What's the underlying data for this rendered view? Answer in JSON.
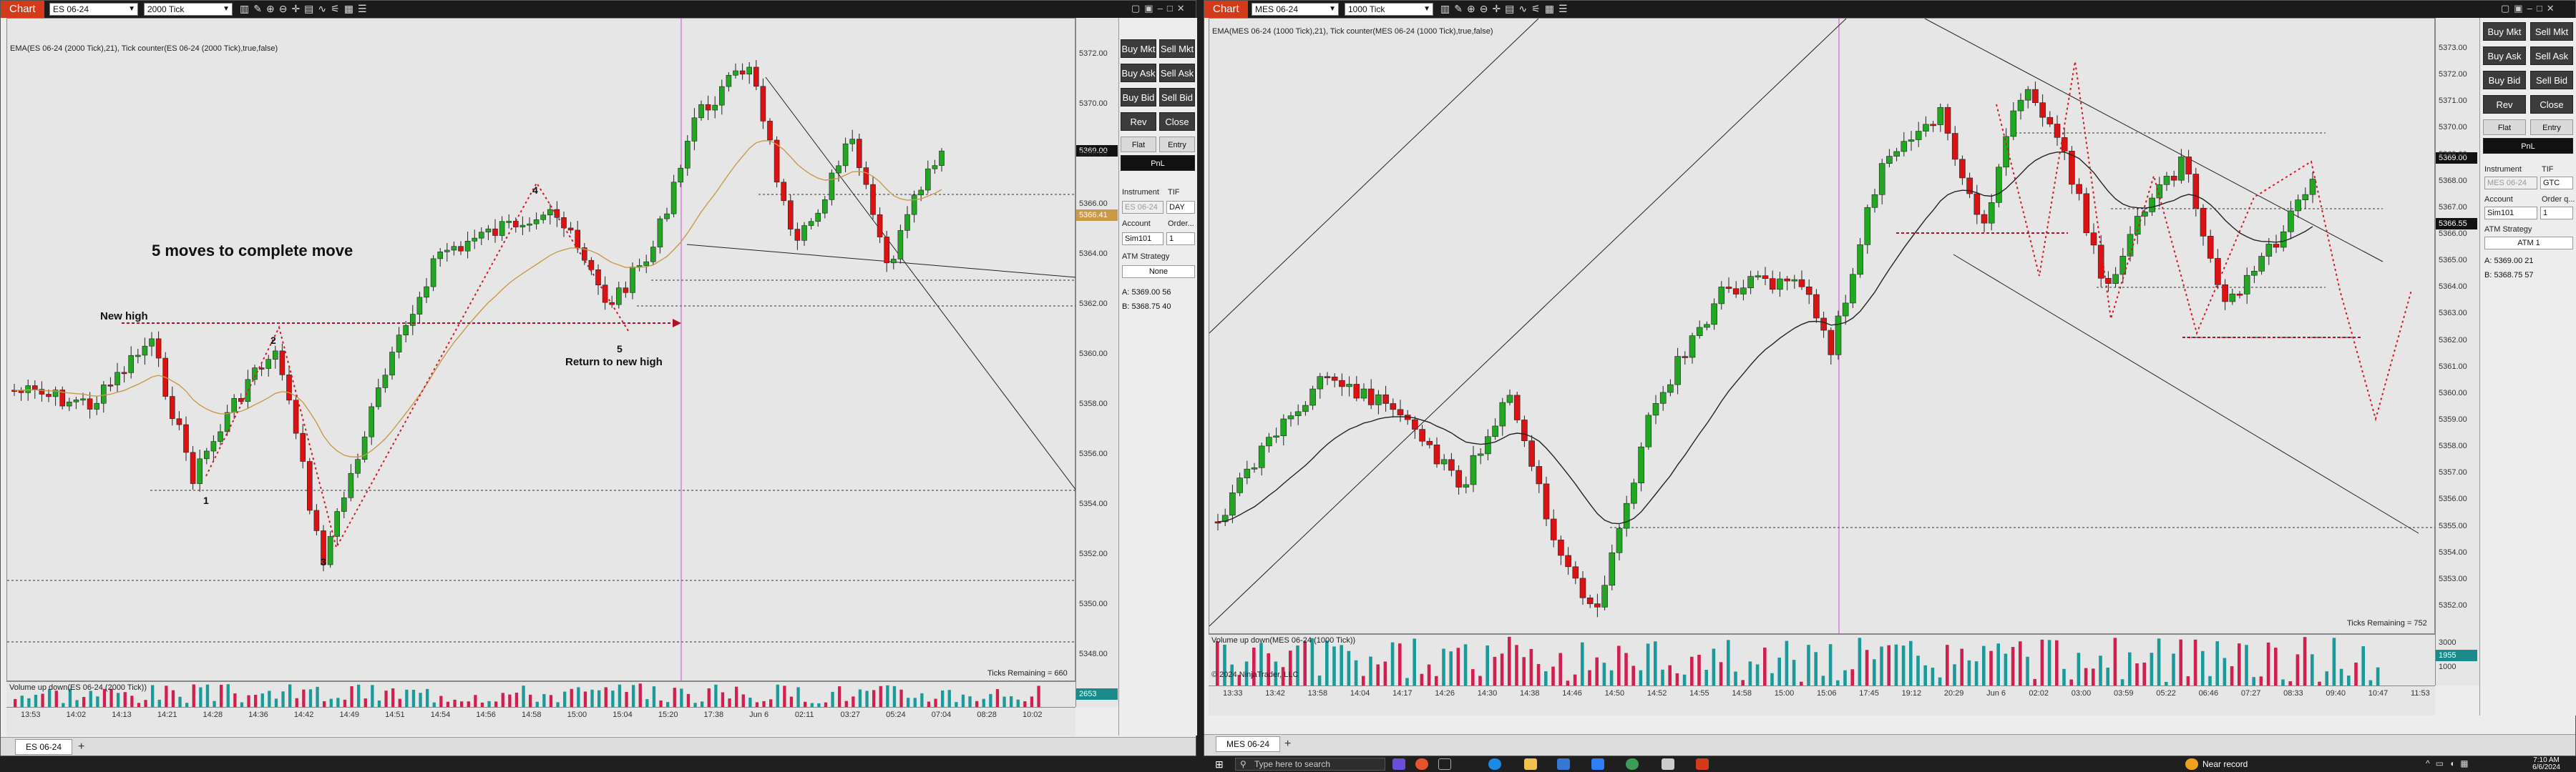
{
  "left": {
    "chart_tag": "Chart",
    "instrument_select": "ES 06-24",
    "interval_select": "2000 Tick",
    "indicator_label": "EMA(ES 06-24 (2000 Tick),21), Tick counter(ES 06-24 (2000 Tick),true,false)",
    "y_ticks": [
      "5372.00",
      "5370.00",
      "5368.00",
      "5366.00",
      "5364.00",
      "5362.00",
      "5360.00",
      "5358.00",
      "5356.00",
      "5354.00",
      "5352.00",
      "5350.00",
      "5348.00"
    ],
    "price_tag_last": "5369.00",
    "price_tag_ema": "5366.41",
    "x_ticks": [
      "13:53",
      "14:02",
      "14:13",
      "14:21",
      "14:28",
      "14:36",
      "14:42",
      "14:49",
      "14:51",
      "14:54",
      "14:56",
      "14:58",
      "15:00",
      "15:04",
      "15:20",
      "17:38",
      "Jun 6",
      "02:11",
      "03:27",
      "05:24",
      "07:04",
      "08:28",
      "10:02"
    ],
    "annotations": {
      "headline": "5 moves to complete move",
      "new_high": "New high",
      "return_new_high": "Return to new high",
      "n1": "1",
      "n2": "2",
      "n3": "3",
      "n4": "4",
      "n5": "5"
    },
    "ticks_remaining": "Ticks Remaining = 660",
    "volume_label": "Volume up down(ES 06-24 (2000 Tick))",
    "volume_value": "2653",
    "tab": "ES 06-24",
    "side": {
      "buttons": [
        "Buy Mkt",
        "Sell Mkt",
        "Buy Ask",
        "Sell Ask",
        "Buy Bid",
        "Sell Bid",
        "Rev",
        "Close"
      ],
      "flat": "Flat",
      "entry": "Entry",
      "pnl": "PnL",
      "instrument_label": "Instrument",
      "tif_label": "TIF",
      "instrument_value": "ES 06-24",
      "tif_value": "DAY",
      "account_label": "Account",
      "order_label": "Order...",
      "account_value": "Sim101",
      "order_qty": "1",
      "atm_label": "ATM Strategy",
      "atm_value": "None",
      "ask": "A:  5369.00   56",
      "bid": "B:  5368.75   40"
    }
  },
  "right": {
    "chart_tag": "Chart",
    "instrument_select": "MES 06-24",
    "interval_select": "1000 Tick",
    "indicator_label": "EMA(MES 06-24 (1000 Tick),21), Tick counter(MES 06-24 (1000 Tick),true,false)",
    "y_ticks": [
      "5373.00",
      "5372.00",
      "5371.00",
      "5370.00",
      "5369.00",
      "5368.00",
      "5367.00",
      "5366.00",
      "5365.00",
      "5364.00",
      "5363.00",
      "5362.00",
      "5361.00",
      "5360.00",
      "5359.00",
      "5358.00",
      "5357.00",
      "5356.00",
      "5355.00",
      "5354.00",
      "5353.00",
      "5352.00"
    ],
    "price_tag_last": "5369.00",
    "price_tag_ema": "5366.55",
    "x_ticks": [
      "13:33",
      "13:42",
      "13:58",
      "14:04",
      "14:17",
      "14:26",
      "14:30",
      "14:38",
      "14:46",
      "14:50",
      "14:52",
      "14:55",
      "14:58",
      "15:00",
      "15:06",
      "17:45",
      "19:12",
      "20:29",
      "Jun 6",
      "02:02",
      "03:00",
      "03:59",
      "05:22",
      "06:46",
      "07:27",
      "08:33",
      "09:40",
      "10:47",
      "11:53"
    ],
    "ticks_remaining": "Ticks Remaining = 752",
    "volume_label": "Volume up down(MES 06-24 (1000 Tick))",
    "copyright": "© 2024 NinjaTrader, LLC",
    "vol_ticks": [
      "3000",
      "2000",
      "1000"
    ],
    "volume_value": "1955",
    "tab": "MES 06-24",
    "side": {
      "buttons": [
        "Buy Mkt",
        "Sell Mkt",
        "Buy Ask",
        "Sell Ask",
        "Buy Bid",
        "Sell Bid",
        "Rev",
        "Close"
      ],
      "flat": "Flat",
      "entry": "Entry",
      "pnl": "PnL",
      "instrument_label": "Instrument",
      "tif_label": "TIF",
      "instrument_value": "MES 06-24",
      "tif_value": "GTC",
      "account_label": "Account",
      "order_label": "Order q...",
      "account_value": "Sim101",
      "order_qty": "1",
      "atm_label": "ATM Strategy",
      "atm_value": "ATM 1",
      "ask": "A:  5369.00   21",
      "bid": "B:  5368.75   57"
    }
  },
  "taskbar": {
    "search_placeholder": "Type here to search",
    "weather": "Near record",
    "time": "7:10 AM",
    "date": "6/6/2024"
  },
  "colors": {
    "up": "#22a722",
    "down": "#dd1111",
    "ema_left": "#c89a4a",
    "ema_right": "#222222",
    "accent": "#d33a1a",
    "session_line": "#d24fd2"
  }
}
